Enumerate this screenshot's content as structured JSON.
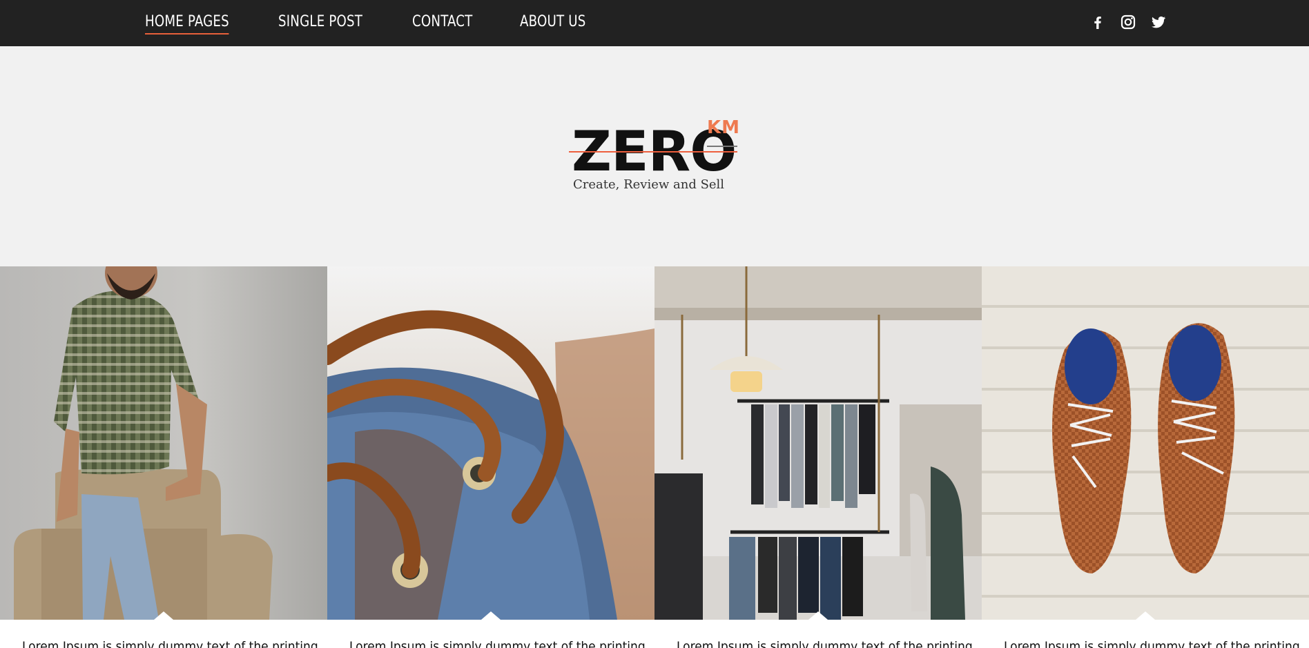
{
  "nav": {
    "items": [
      {
        "label": "HOME PAGES",
        "active": true
      },
      {
        "label": "SINGLE POST",
        "active": false
      },
      {
        "label": "CONTACT",
        "active": false
      },
      {
        "label": "ABOUT US",
        "active": false
      }
    ],
    "social_icons": [
      "facebook-icon",
      "instagram-icon",
      "twitter-icon"
    ]
  },
  "brand": {
    "word": "ZERO",
    "superscript": "KM",
    "tagline": "Create, Review and Sell",
    "accent_color": "#ee5e3c"
  },
  "gallery": {
    "tiles": [
      {
        "image": "man-in-plaid-shirt-photo",
        "caption": "Lorem Ipsum is simply dummy text of the printing"
      },
      {
        "image": "shoe-laces-closeup-photo",
        "caption": "Lorem Ipsum is simply dummy text of the printing"
      },
      {
        "image": "clothing-store-rack-photo",
        "caption": "Lorem Ipsum is simply dummy text of the printing"
      },
      {
        "image": "brown-leather-shoes-photo",
        "caption": "Lorem Ipsum is simply dummy text of the printing"
      }
    ]
  },
  "colors": {
    "topbar": "#222222",
    "hero_bg": "#f1f1f1",
    "accent": "#e9603a"
  }
}
